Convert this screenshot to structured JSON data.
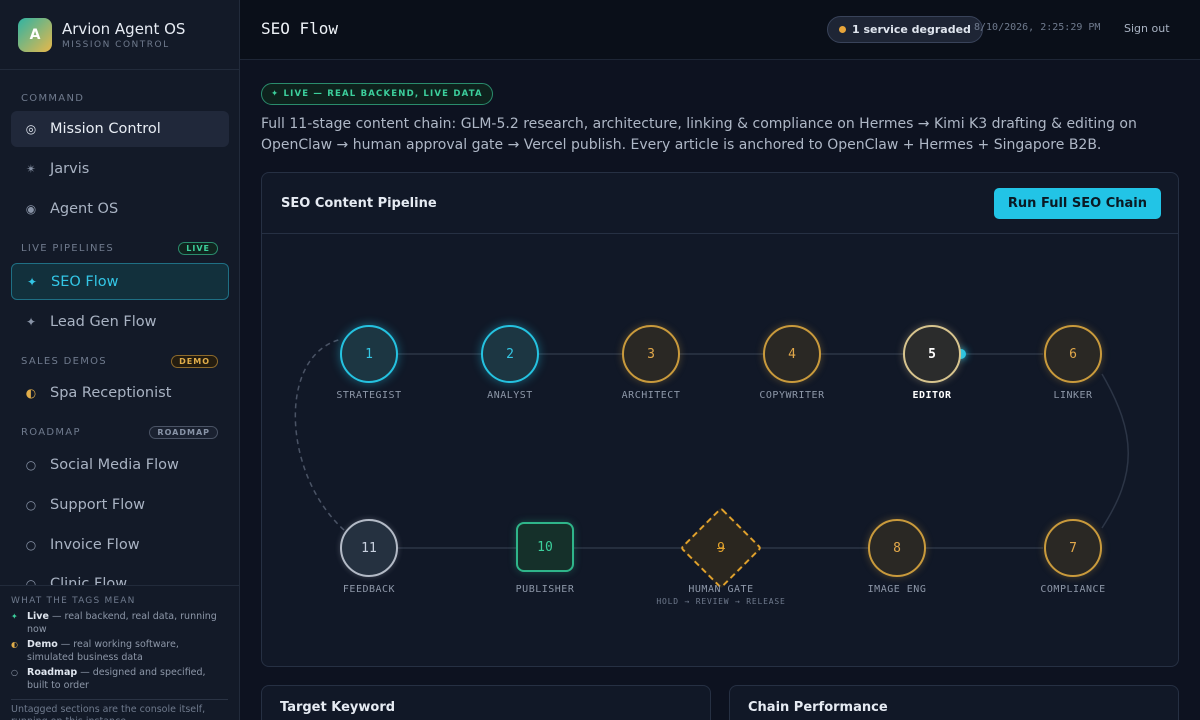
{
  "brand": {
    "logo": "A",
    "title": "Arvion Agent OS",
    "subtitle": "MISSION CONTROL"
  },
  "sidebar": {
    "sections": {
      "command": "COMMAND",
      "live": {
        "label": "LIVE PIPELINES",
        "badge": "LIVE"
      },
      "demos": {
        "label": "SALES DEMOS",
        "badge": "DEMO"
      },
      "roadmap": {
        "label": "ROADMAP",
        "badge": "ROADMAP"
      }
    },
    "items": {
      "mission": "Mission Control",
      "jarvis": "Jarvis",
      "agentos": "Agent OS",
      "seo": "SEO Flow",
      "leadgen": "Lead Gen Flow",
      "spa": "Spa Receptionist",
      "social": "Social Media Flow",
      "support": "Support Flow",
      "invoice": "Invoice Flow",
      "clinic": "Clinic Flow"
    },
    "legend": {
      "title": "WHAT THE TAGS MEAN",
      "live_term": "Live",
      "live_desc": " — real backend, real data, running now",
      "demo_term": "Demo",
      "demo_desc": " — real working software, simulated business data",
      "roadmap_term": "Roadmap",
      "roadmap_desc": " — designed and specified, built to order",
      "footer": "Untagged sections are the console itself, running on this instance."
    }
  },
  "header": {
    "title": "SEO Flow",
    "status": "1 service degraded",
    "timestamp": "8/10/2026, 2:25:29 PM",
    "signout": "Sign out"
  },
  "main": {
    "live_tag": "✦ LIVE — REAL BACKEND, LIVE DATA",
    "intro": "Full 11-stage content chain: GLM-5.2 research, architecture, linking & compliance on Hermes → Kimi K3 drafting & editing on OpenClaw → human approval gate → Vercel publish. Every article is anchored to OpenClaw + Hermes + Singapore B2B.",
    "panel_title": "SEO Content Pipeline",
    "run_button": "Run Full SEO Chain",
    "stages": [
      {
        "num": "1",
        "label": "STRATEGIST"
      },
      {
        "num": "2",
        "label": "ANALYST"
      },
      {
        "num": "3",
        "label": "ARCHITECT"
      },
      {
        "num": "4",
        "label": "COPYWRITER"
      },
      {
        "num": "5",
        "label": "EDITOR"
      },
      {
        "num": "6",
        "label": "LINKER"
      },
      {
        "num": "7",
        "label": "COMPLIANCE"
      },
      {
        "num": "8",
        "label": "IMAGE ENG"
      },
      {
        "num": "9",
        "label": "HUMAN GATE",
        "sub": "HOLD → REVIEW → RELEASE"
      },
      {
        "num": "10",
        "label": "PUBLISHER"
      },
      {
        "num": "11",
        "label": "FEEDBACK"
      }
    ],
    "cards": {
      "keyword": "Target Keyword",
      "performance": "Chain Performance"
    }
  },
  "colors": {
    "accent": "#22c4e6",
    "live": "#3ccf9c",
    "demo": "#e0ad4a",
    "warning": "#e8a53a"
  }
}
